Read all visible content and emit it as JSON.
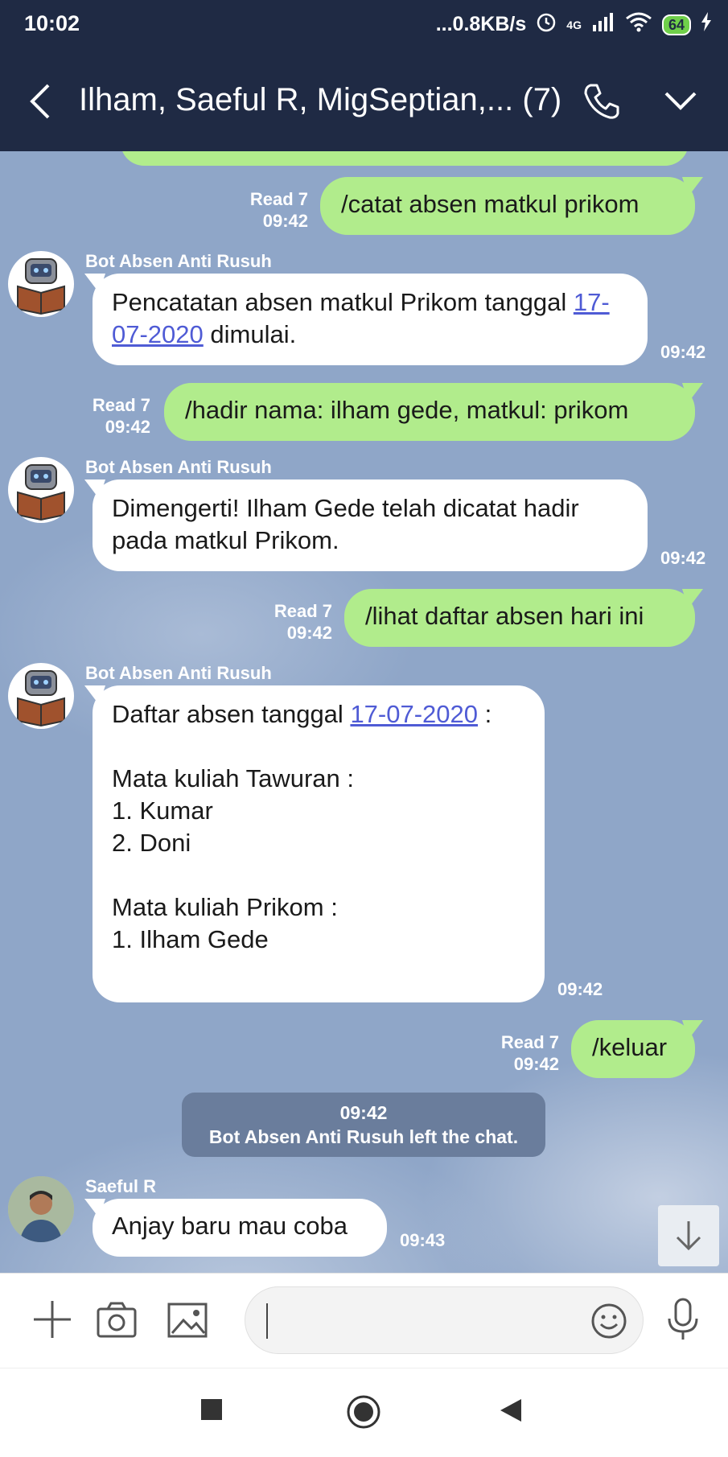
{
  "status_bar": {
    "time": "10:02",
    "network": "...0.8KB/s",
    "signal": "4G",
    "battery": "64"
  },
  "header": {
    "title": "Ilham, Saeful R, MigSeptian,... (7)",
    "back_icon": "chevron-left-icon",
    "call_icon": "phone-icon",
    "more_icon": "chevron-down-icon"
  },
  "messages": [
    {
      "type": "sent",
      "text": "/catat absen matkul prikom",
      "read": "Read 7",
      "time": "09:42"
    },
    {
      "type": "received",
      "sender": "Bot Absen Anti Rusuh",
      "text_before": "Pencatatan absen matkul Prikom tanggal ",
      "link": "17-07-2020",
      "text_after": " dimulai.",
      "time": "09:42"
    },
    {
      "type": "sent",
      "text": "/hadir nama: ilham gede, matkul: prikom",
      "read": "Read 7",
      "time": "09:42"
    },
    {
      "type": "received",
      "sender": "Bot Absen Anti Rusuh",
      "text": "Dimengerti! Ilham Gede telah dicatat hadir pada matkul Prikom.",
      "time": "09:42"
    },
    {
      "type": "sent",
      "text": "/lihat daftar absen hari ini",
      "read": "Read 7",
      "time": "09:42"
    },
    {
      "type": "received",
      "sender": "Bot Absen Anti Rusuh",
      "first_before": "Daftar absen tanggal ",
      "link": "17-07-2020",
      "first_after": " :",
      "lines": [
        "",
        "Mata kuliah Tawuran :",
        "1. Kumar",
        "2. Doni",
        "",
        "Mata kuliah Prikom :",
        "1. Ilham Gede"
      ],
      "time": "09:42"
    },
    {
      "type": "sent",
      "text": "/keluar",
      "read": "Read 7",
      "time": "09:42"
    },
    {
      "type": "system",
      "time": "09:42",
      "text": "Bot Absen Anti Rusuh left the chat."
    },
    {
      "type": "received",
      "sender": "Saeful R",
      "text": "Anjay baru mau coba",
      "time": "09:43"
    }
  ],
  "input_bar": {
    "placeholder": "",
    "icons": [
      "plus-icon",
      "camera-icon",
      "image-icon",
      "emoji-icon",
      "microphone-icon"
    ]
  },
  "nav_bar": {
    "icons": [
      "recent-apps-icon",
      "home-icon",
      "back-icon"
    ]
  },
  "colors": {
    "header_bg": "#1f2a44",
    "sent_bubble": "#b1ec8c",
    "received_bubble": "#ffffff",
    "chat_bg": "#8fa6c8",
    "link": "#4f5bd5"
  }
}
